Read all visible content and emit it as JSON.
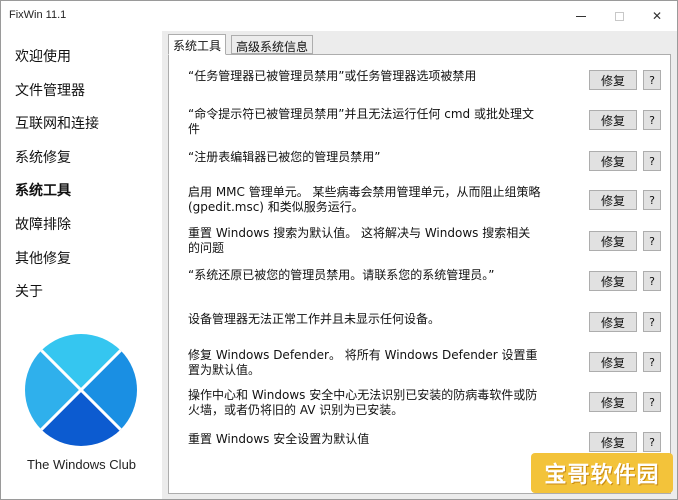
{
  "window": {
    "title": "FixWin 11.1",
    "close_glyph": "✕"
  },
  "sidebar": {
    "items": [
      {
        "label": "欢迎使用"
      },
      {
        "label": "文件管理器"
      },
      {
        "label": "互联网和连接"
      },
      {
        "label": "系统修复"
      },
      {
        "label": "系统工具",
        "active": true
      },
      {
        "label": "故障排除"
      },
      {
        "label": "其他修复"
      },
      {
        "label": "关于"
      }
    ],
    "logo_caption": "The Windows Club"
  },
  "tabs": [
    {
      "label": "系统工具",
      "active": true
    },
    {
      "label": "高级系统信息",
      "active": false
    }
  ],
  "fixes": [
    {
      "text": "“任务管理器已被管理员禁用”或任务管理器选项被禁用",
      "button": "修复",
      "help": "?"
    },
    {
      "text": "“命令提示符已被管理员禁用”并且无法运行任何 cmd 或批处理文件",
      "button": "修复",
      "help": "?"
    },
    {
      "text": "“注册表编辑器已被您的管理员禁用”",
      "button": "修复",
      "help": "?"
    },
    {
      "text": "启用 MMC 管理单元。 某些病毒会禁用管理单元，从而阻止组策略 (gpedit.msc) 和类似服务运行。",
      "button": "修复",
      "help": "?"
    },
    {
      "text": "重置 Windows 搜索为默认值。 这将解决与 Windows 搜索相关的问题",
      "button": "修复",
      "help": "?"
    },
    {
      "text": "“系统还原已被您的管理员禁用。请联系您的系统管理员。”",
      "button": "修复",
      "help": "?"
    },
    {
      "text": "设备管理器无法正常工作并且未显示任何设备。",
      "button": "修复",
      "help": "?"
    },
    {
      "text": "修复 Windows Defender。 将所有 Windows Defender 设置重置为默认值。",
      "button": "修复",
      "help": "?"
    },
    {
      "text": "操作中心和 Windows 安全中心无法识别已安装的防病毒软件或防火墙，或者仍将旧的 AV 识别为已安装。",
      "button": "修复",
      "help": "?"
    },
    {
      "text": "重置 Windows 安全设置为默认值",
      "button": "修复",
      "help": "?"
    }
  ],
  "watermark": {
    "text": "宝哥软件园"
  },
  "colors": {
    "logo_top": "#35c6f0",
    "logo_left": "#2fb0ec",
    "logo_right": "#1a8fe3",
    "logo_bottom": "#0c5bd0",
    "watermark_bg": "#f3c33a"
  }
}
